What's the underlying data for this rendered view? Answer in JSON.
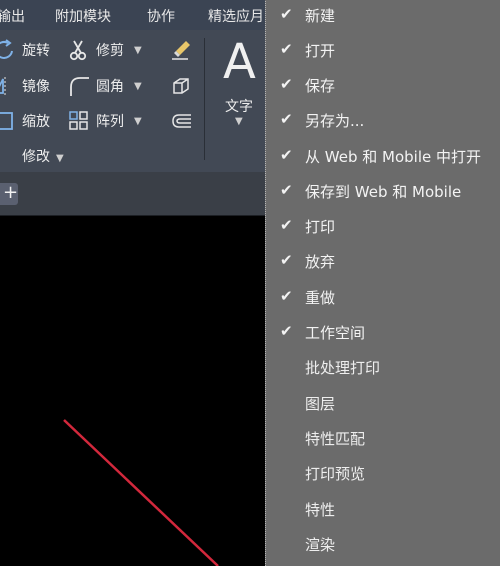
{
  "menu_tabs": [
    {
      "label": "输出"
    },
    {
      "label": "附加模块"
    },
    {
      "label": "协作"
    },
    {
      "label": "精选应月"
    }
  ],
  "modify_panel": {
    "title": "修改",
    "tools": [
      {
        "label": "旋转",
        "icon": "rotate-icon"
      },
      {
        "label": "修剪",
        "icon": "trim-scissors-icon"
      },
      {
        "label": "镜像",
        "icon": "mirror-icon"
      },
      {
        "label": "圆角",
        "icon": "fillet-icon"
      },
      {
        "label": "缩放",
        "icon": "scale-icon"
      },
      {
        "label": "阵列",
        "icon": "array-icon"
      }
    ]
  },
  "annotation_panel": {
    "big_icon": "A",
    "label": "文字"
  },
  "file_tabs": {
    "new_tab_symbol": "+"
  },
  "context_menu": {
    "items": [
      {
        "label": "新建",
        "checked": true
      },
      {
        "label": "打开",
        "checked": true
      },
      {
        "label": "保存",
        "checked": true
      },
      {
        "label": "另存为...",
        "checked": true
      },
      {
        "label": "从 Web 和 Mobile 中打开",
        "checked": true
      },
      {
        "label": "保存到 Web 和 Mobile",
        "checked": true
      },
      {
        "label": "打印",
        "checked": true
      },
      {
        "label": "放弃",
        "checked": true
      },
      {
        "label": "重做",
        "checked": true
      },
      {
        "label": "工作空间",
        "checked": true
      },
      {
        "label": "批处理打印",
        "checked": false
      },
      {
        "label": "图层",
        "checked": false
      },
      {
        "label": "特性匹配",
        "checked": false
      },
      {
        "label": "打印预览",
        "checked": false
      },
      {
        "label": "特性",
        "checked": false
      },
      {
        "label": "渲染",
        "checked": false
      }
    ],
    "check_glyph": "✔"
  },
  "colors": {
    "ribbon_bg": "#424955",
    "menu_bg": "#6b6b6b",
    "line_red": "#d2283c"
  }
}
